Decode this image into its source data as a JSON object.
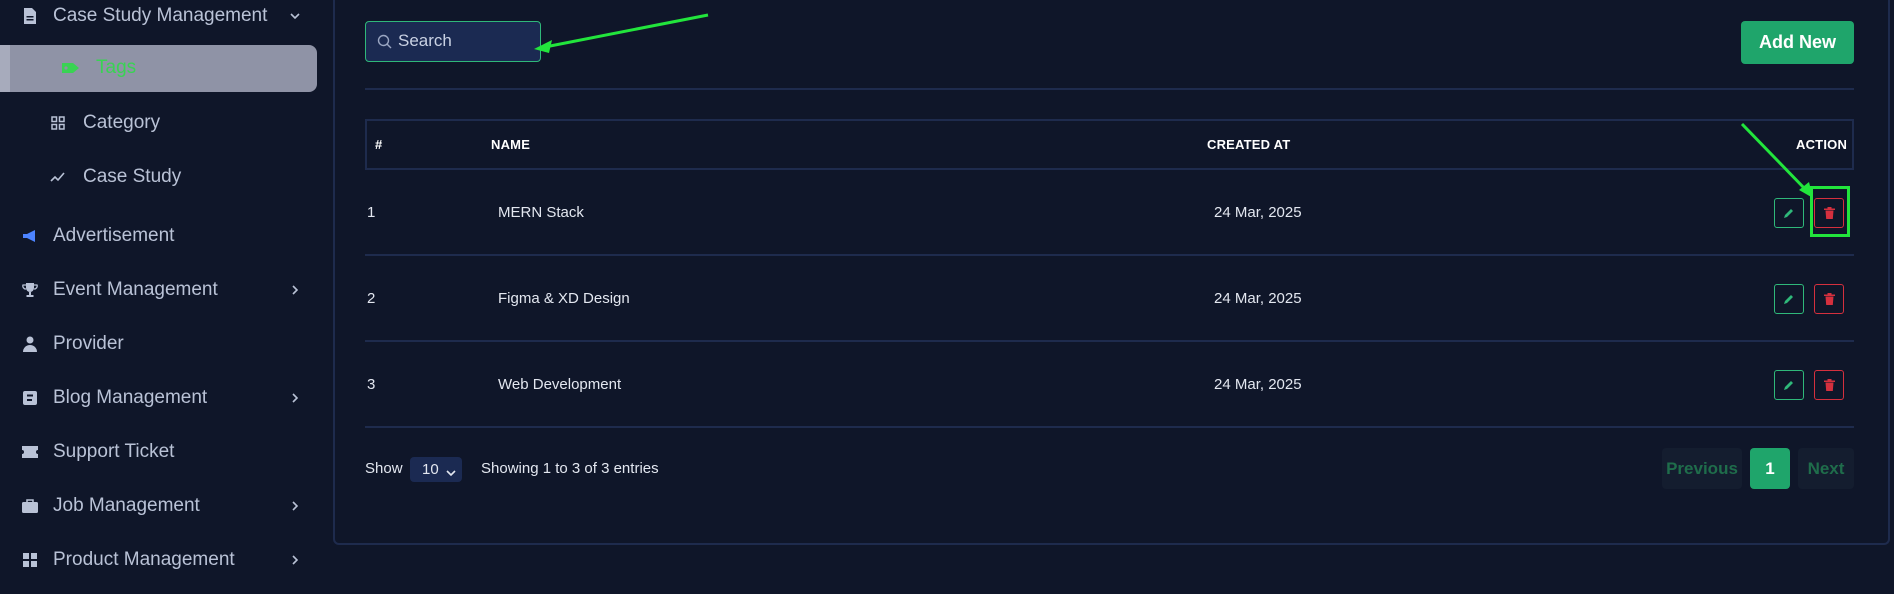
{
  "sidebar": {
    "items": [
      {
        "label": "Case Study Management",
        "icon": "document-icon"
      },
      {
        "label": "Tags",
        "icon": "tag-icon"
      },
      {
        "label": "Category",
        "icon": "grid-icon"
      },
      {
        "label": "Case Study",
        "icon": "trend-icon"
      },
      {
        "label": "Advertisement",
        "icon": "megaphone-icon"
      },
      {
        "label": "Event Management",
        "icon": "trophy-icon"
      },
      {
        "label": "Provider",
        "icon": "person-icon"
      },
      {
        "label": "Blog Management",
        "icon": "blog-icon"
      },
      {
        "label": "Support Ticket",
        "icon": "ticket-icon"
      },
      {
        "label": "Job Management",
        "icon": "briefcase-icon"
      },
      {
        "label": "Product Management",
        "icon": "apps-icon"
      }
    ]
  },
  "toolbar": {
    "search_placeholder": "Search",
    "add_label": "Add New"
  },
  "table": {
    "columns": [
      "#",
      "NAME",
      "CREATED AT",
      "ACTION"
    ],
    "rows": [
      {
        "num": "1",
        "name": "MERN Stack",
        "created_at": "24 Mar, 2025"
      },
      {
        "num": "2",
        "name": "Figma & XD Design",
        "created_at": "24 Mar, 2025"
      },
      {
        "num": "3",
        "name": "Web Development",
        "created_at": "24 Mar, 2025"
      }
    ]
  },
  "footer": {
    "show_label": "Show",
    "page_size": "10",
    "entries_text": "Showing 1 to 3 of 3 entries"
  },
  "pagination": {
    "previous": "Previous",
    "current": "1",
    "next": "Next"
  },
  "colors": {
    "background": "#0f1629",
    "accent_green": "#1fa56b",
    "delete_red": "#d5303e",
    "annotation_green": "#22e53c"
  }
}
